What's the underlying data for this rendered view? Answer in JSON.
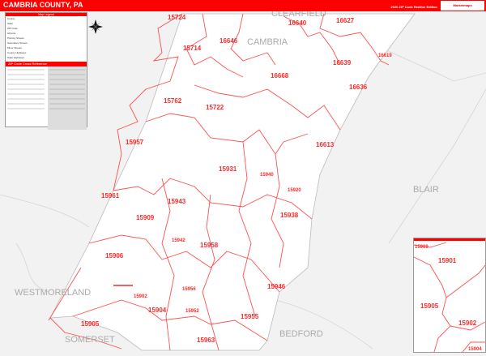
{
  "header": {
    "title": "CAMBRIA COUNTY, PA",
    "edition": "2020 ZIP Code Redline Edition",
    "logo_text": "Marketmaps"
  },
  "colors": {
    "accent": "#ff0000",
    "zip_boundary": "#ff5050",
    "background": "#f2f2f2",
    "county_fill": "#ffffff"
  },
  "legend": {
    "title": "Map Legend",
    "items": [
      "County",
      "State",
      "ZIP Code",
      "Airports",
      "Primary Streets",
      "Secondary Streets",
      "Minor Streets",
      "County Highways",
      "State Highways",
      "US Highways",
      "Interstate Highways",
      "Toll Roads"
    ],
    "xref_title": "ZIP Code Cross Reference"
  },
  "compass": "compass-rose-icon",
  "counties": {
    "cambria": "CAMBRIA",
    "blair": "BLAIR",
    "bedford": "BEDFORD",
    "somerset": "SOMERSET",
    "westmoreland": "WESTMORELAND",
    "clearfield": "CLEARFIELD"
  },
  "zips": {
    "z15724": "15724",
    "z16640": "16640",
    "z16627": "16627",
    "z16646": "16646",
    "z15714": "15714",
    "z16619": "16619",
    "z16639": "16639",
    "z16668": "16668",
    "z16636": "16636",
    "z15762": "15762",
    "z15722": "15722",
    "z16613": "16613",
    "z15957": "15957",
    "z15931": "15931",
    "z15940": "15940",
    "z15961": "15961",
    "z15943": "15943",
    "z15909": "15909",
    "z15938": "15938",
    "z15946": "15946",
    "z15942": "15942",
    "z15958": "15958",
    "z15906": "15906",
    "z15902": "15902",
    "z15956": "15956",
    "z15904": "15904",
    "z15955": "15955",
    "z15905": "15905",
    "z15963": "15963",
    "z15952": "15952",
    "z15920": "15920"
  },
  "inset": {
    "zips": {
      "a": "15909",
      "b": "15901",
      "c": "15905",
      "d": "15902",
      "e": "15904"
    }
  }
}
